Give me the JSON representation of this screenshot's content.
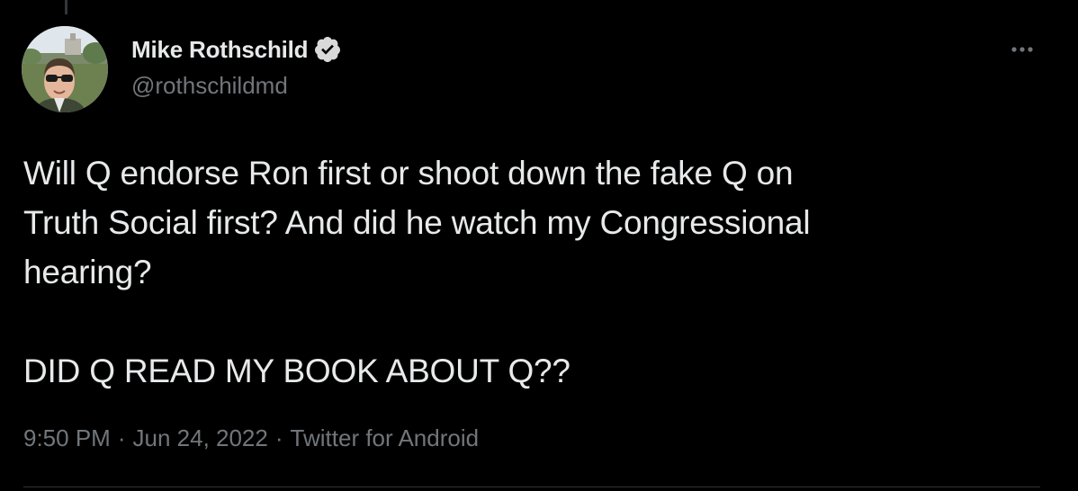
{
  "tweet": {
    "author": {
      "display_name": "Mike Rothschild",
      "handle": "@rothschildmd",
      "verified": true,
      "avatar_icon": "avatar-photo"
    },
    "more_icon": "ellipsis-icon",
    "text_lines": [
      "Will Q endorse Ron first or shoot down the fake Q on",
      "Truth Social first? And did he watch my Congressional",
      "hearing?"
    ],
    "text_paragraph_2": "DID Q READ MY BOOK ABOUT Q??",
    "time": "9:50 PM",
    "date": "Jun 24, 2022",
    "source": "Twitter for Android",
    "separator": "·"
  },
  "colors": {
    "background": "#000000",
    "primary_text": "#e7e9ea",
    "secondary_text": "#71767b",
    "divider": "#2f3336",
    "verified_badge": "#d9d9d9"
  }
}
